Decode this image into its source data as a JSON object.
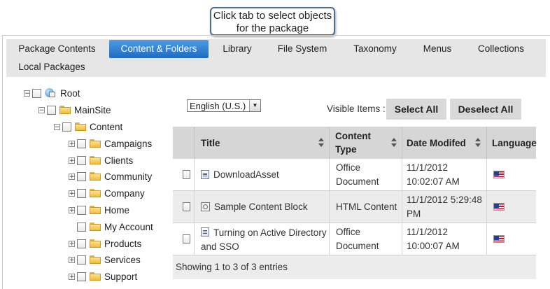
{
  "callout": {
    "line1": "Click tab to select objects",
    "line2": "for the package"
  },
  "tabs": [
    {
      "label": "Package Contents"
    },
    {
      "label": "Content & Folders",
      "active": true
    },
    {
      "label": "Library"
    },
    {
      "label": "File System"
    },
    {
      "label": "Taxonomy"
    },
    {
      "label": "Menus"
    },
    {
      "label": "Collections"
    },
    {
      "label": "Local Packages"
    }
  ],
  "tree": [
    {
      "label": "Root",
      "icon": "home-globe-icon",
      "expander": "minus"
    },
    {
      "label": "MainSite",
      "icon": "folder-icon",
      "expander": "minus"
    },
    {
      "label": "Content",
      "icon": "folder-icon",
      "expander": "minus"
    },
    {
      "label": "Campaigns",
      "icon": "folder-icon",
      "expander": "plus"
    },
    {
      "label": "Clients",
      "icon": "folder-icon",
      "expander": "plus"
    },
    {
      "label": "Community",
      "icon": "folder-icon",
      "expander": "plus"
    },
    {
      "label": "Company",
      "icon": "folder-icon",
      "expander": "plus"
    },
    {
      "label": "Home",
      "icon": "folder-icon",
      "expander": "plus"
    },
    {
      "label": "My Account",
      "icon": "folder-icon",
      "expander": "none"
    },
    {
      "label": "Products",
      "icon": "folder-icon",
      "expander": "plus"
    },
    {
      "label": "Services",
      "icon": "folder-icon",
      "expander": "plus"
    },
    {
      "label": "Support",
      "icon": "folder-icon",
      "expander": "plus"
    }
  ],
  "language_select": {
    "value": "English (U.S.)"
  },
  "visible_items_label": "Visible Items :",
  "select_all_label": "Select All",
  "deselect_all_label": "Deselect All",
  "table": {
    "headers": {
      "title": "Title",
      "content_type": "Content Type",
      "date_modified": "Date Modifed",
      "language": "Language"
    },
    "rows": [
      {
        "title": "DownloadAsset",
        "icon": "document-icon",
        "content_type": "Office Document",
        "date_modified": "11/1/2012 10:02:07 AM",
        "language": "us-flag-icon"
      },
      {
        "title": "Sample Content Block",
        "icon": "html-content-icon",
        "content_type": "HTML Content",
        "date_modified": "11/1/2012 5:29:48 PM",
        "language": "us-flag-icon"
      },
      {
        "title": "Turning on Active Directory and SSO",
        "icon": "document-icon",
        "content_type": "Office Document",
        "date_modified": "11/1/2012 10:00:07 AM",
        "language": "us-flag-icon"
      }
    ],
    "footer": "Showing 1 to 3 of 3 entries"
  }
}
